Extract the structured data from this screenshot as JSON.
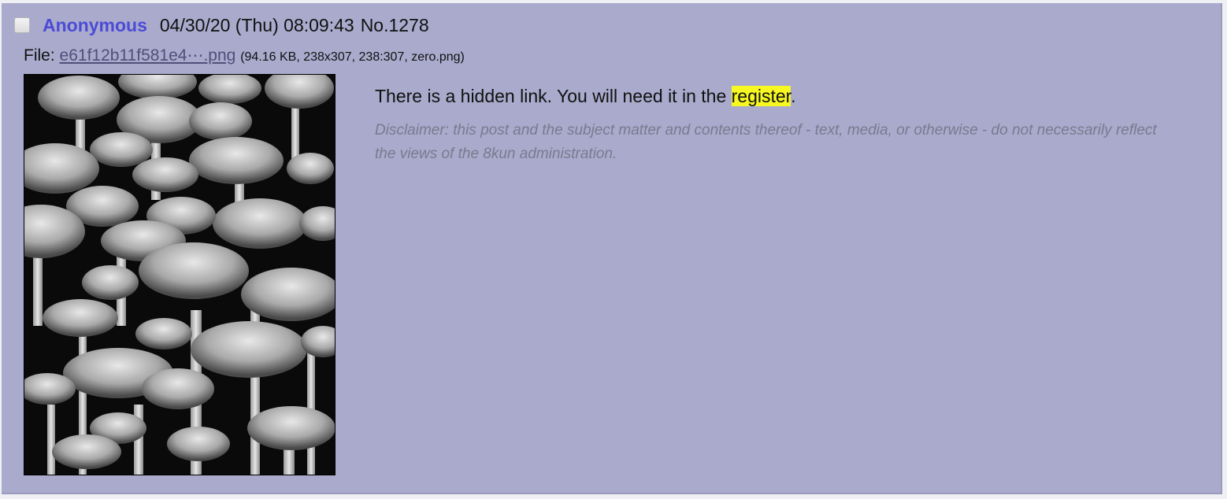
{
  "post": {
    "name": "Anonymous",
    "date": "04/30/20 (Thu) 08:09:43",
    "number": "No.1278",
    "file": {
      "label": "File:",
      "filename": "e61f12b11f581e4⋯.png",
      "meta": "(94.16 KB, 238x307, 238:307, zero.png)",
      "image_alt": "black and white mushrooms cluster"
    },
    "message": {
      "before": "There is a hidden link. You will need it in the ",
      "highlight": "register",
      "after": "."
    },
    "disclaimer": "Disclaimer: this post and the subject matter and contents thereof - text, media, or otherwise - do not necessarily reflect the views of the 8kun administration."
  },
  "colors": {
    "post_bg": "#a9aacc",
    "name": "#4b4bd6",
    "highlight": "#f7f722",
    "disclaimer": "#7a7a8e"
  }
}
